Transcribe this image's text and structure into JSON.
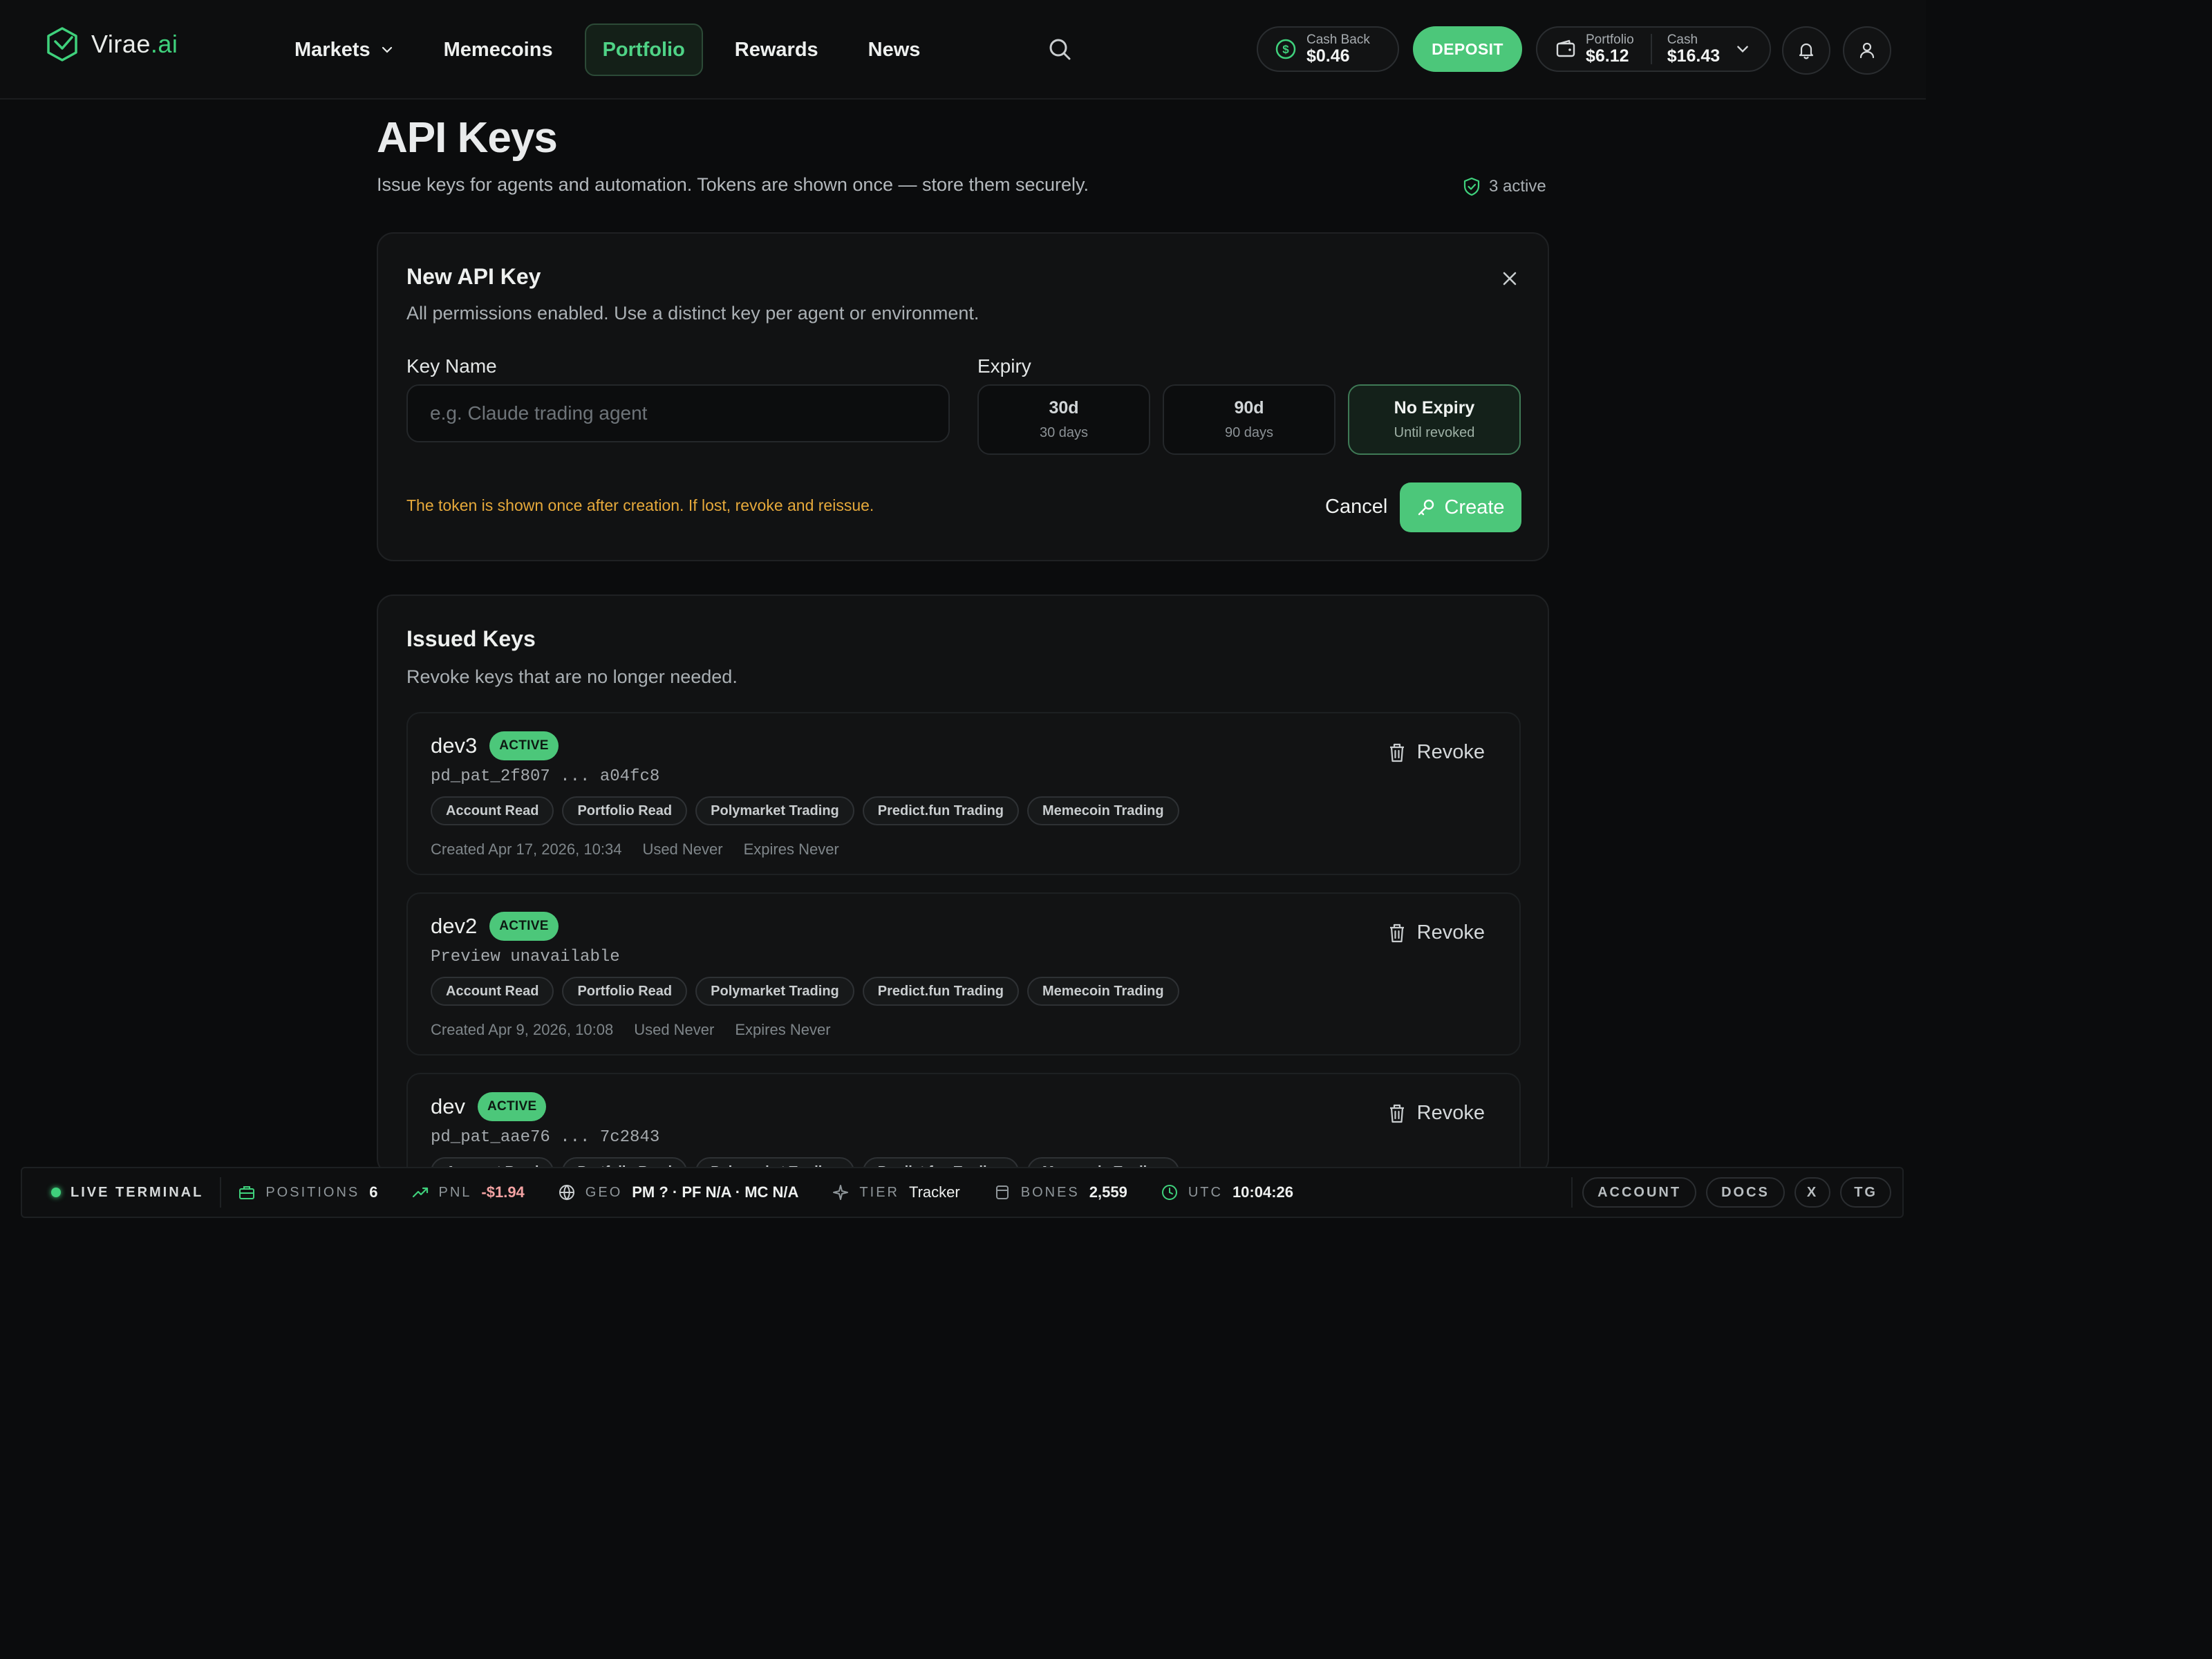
{
  "brand": {
    "name": "Virae",
    "suffix": ".ai"
  },
  "nav": {
    "markets": "Markets",
    "memecoins": "Memecoins",
    "portfolio": "Portfolio",
    "rewards": "Rewards",
    "news": "News"
  },
  "header": {
    "cashback_label": "Cash Back",
    "cashback_value": "$0.46",
    "deposit_label": "DEPOSIT",
    "portfolio_label": "Portfolio",
    "portfolio_value": "$6.12",
    "cash_label": "Cash",
    "cash_value": "$16.43"
  },
  "page": {
    "title": "API Keys",
    "subtitle": "Issue keys for agents and automation. Tokens are shown once — store them securely.",
    "active_count": "3 active"
  },
  "new_key": {
    "title": "New API Key",
    "subtitle": "All permissions enabled. Use a distinct key per agent or environment.",
    "key_name_label": "Key Name",
    "key_name_placeholder": "e.g. Claude trading agent",
    "key_name_value": "",
    "expiry_label": "Expiry",
    "expiry_options": [
      {
        "label": "30d",
        "sub": "30 days",
        "selected": false
      },
      {
        "label": "90d",
        "sub": "90 days",
        "selected": false
      },
      {
        "label": "No Expiry",
        "sub": "Until revoked",
        "selected": true
      }
    ],
    "warning": "The token is shown once after creation. If lost, revoke and reissue.",
    "cancel_label": "Cancel",
    "create_label": "Create"
  },
  "issued": {
    "title": "Issued Keys",
    "subtitle": "Revoke keys that are no longer needed.",
    "revoke_label": "Revoke",
    "keys": [
      {
        "name": "dev3",
        "status": "ACTIVE",
        "token": "pd_pat_2f807 ... a04fc8",
        "permissions": [
          "Account Read",
          "Portfolio Read",
          "Polymarket Trading",
          "Predict.fun Trading",
          "Memecoin Trading"
        ],
        "created": "Created Apr 17, 2026, 10:34",
        "used": "Used Never",
        "expires": "Expires Never"
      },
      {
        "name": "dev2",
        "status": "ACTIVE",
        "token": "Preview unavailable",
        "permissions": [
          "Account Read",
          "Portfolio Read",
          "Polymarket Trading",
          "Predict.fun Trading",
          "Memecoin Trading"
        ],
        "created": "Created Apr 9, 2026, 10:08",
        "used": "Used Never",
        "expires": "Expires Never"
      },
      {
        "name": "dev",
        "status": "ACTIVE",
        "token": "pd_pat_aae76 ... 7c2843",
        "permissions": [
          "Account Read",
          "Portfolio Read",
          "Polymarket Trading",
          "Predict.fun Trading",
          "Memecoin Trading"
        ],
        "created": "",
        "used": "",
        "expires": ""
      }
    ]
  },
  "statusbar": {
    "live": "LIVE TERMINAL",
    "positions_label": "POSITIONS",
    "positions_value": "6",
    "pnl_label": "PNL",
    "pnl_value": "-$1.94",
    "geo_label": "GEO",
    "geo_value": "PM ? · PF N/A · MC N/A",
    "tier_label": "TIER",
    "tier_value": "Tracker",
    "bones_label": "BONES",
    "bones_value": "2,559",
    "utc_label": "UTC",
    "utc_value": "10:04:26",
    "links": [
      "ACCOUNT",
      "DOCS",
      "X",
      "TG"
    ]
  },
  "colors": {
    "accent": "#4cc77a",
    "background": "#0b0c0d",
    "card": "#111213",
    "warning": "#e6a93b",
    "negative": "#f2a2a2"
  },
  "icons": {
    "logo": "hex-check-logo-icon",
    "search": "search-icon",
    "cashback": "dollar-coin-icon",
    "wallet": "wallet-icon",
    "bell": "bell-icon",
    "user": "user-icon",
    "close": "close-icon",
    "key": "key-icon",
    "trash": "trash-icon",
    "shield": "shield-check-icon"
  }
}
